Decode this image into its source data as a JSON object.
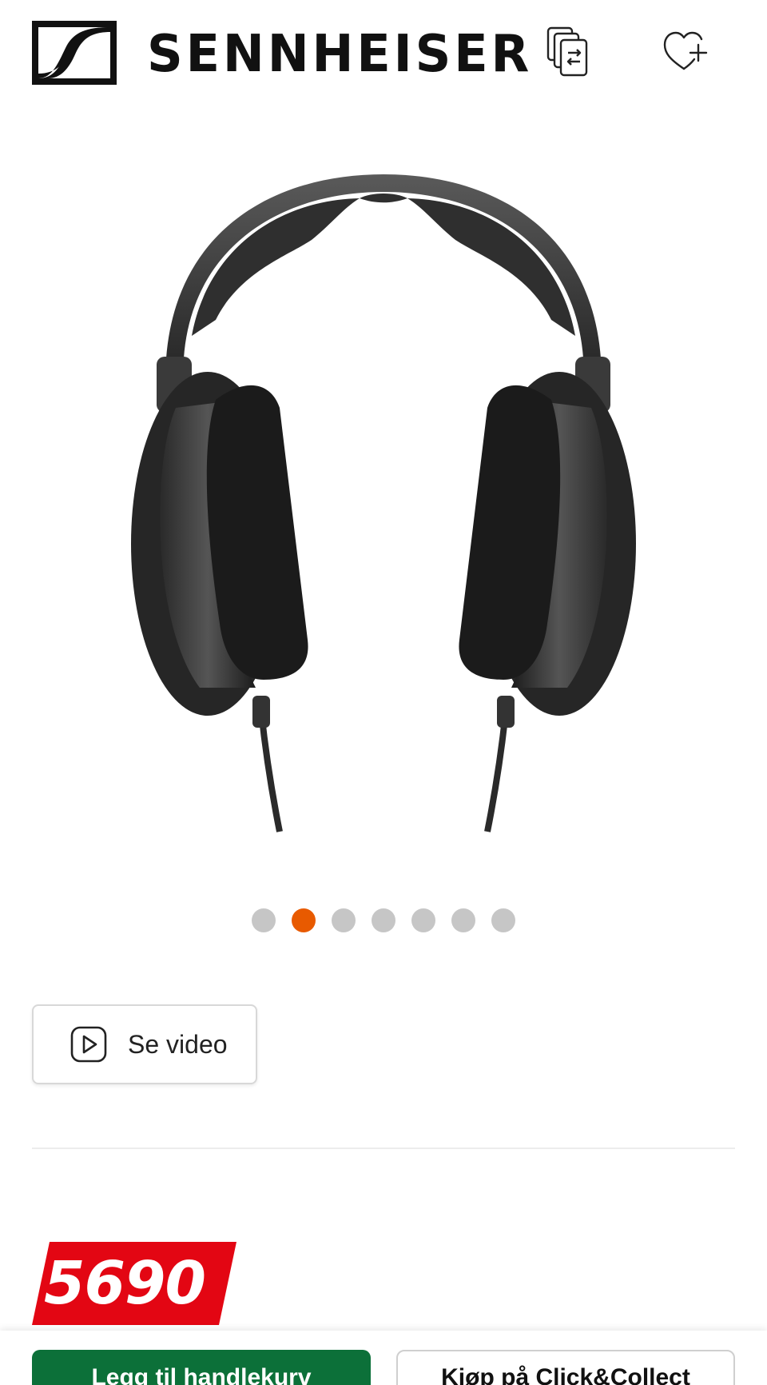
{
  "header": {
    "brand": "SENNHEISER",
    "logo_icon": "sennheiser-logo-icon",
    "compare_icon": "compare-icon",
    "wishlist_icon": "heart-plus-icon"
  },
  "gallery": {
    "image": "sennheiser-open-back-headphones",
    "slide_count": 7,
    "active_slide": 2
  },
  "video": {
    "label": "Se video",
    "icon": "play-icon"
  },
  "price": {
    "value": "5690",
    "tag_color": "#e30613"
  },
  "actions": {
    "add_to_cart": "Legg til handlekurv",
    "click_collect": "Kjøp på Click&Collect"
  },
  "colors": {
    "accent_dot": "#e85a00",
    "cart_button": "#0c7039"
  }
}
